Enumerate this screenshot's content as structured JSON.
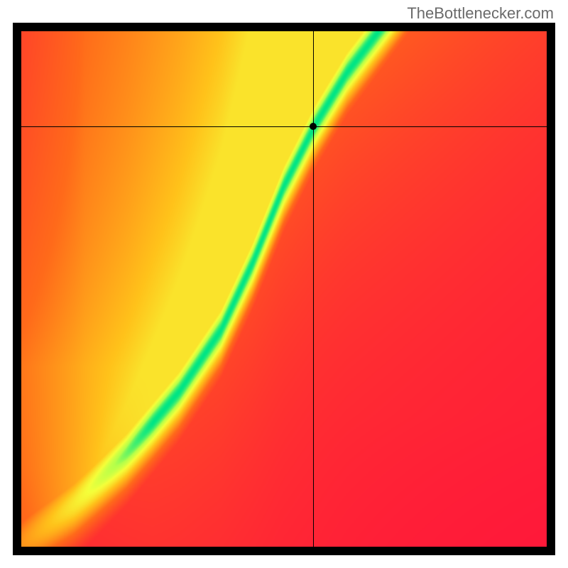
{
  "watermark": "TheBottlenecker.com",
  "chart_data": {
    "type": "heatmap",
    "title": "",
    "xlabel": "",
    "ylabel": "",
    "xlim": [
      0,
      1
    ],
    "ylim": [
      0,
      1
    ],
    "crosshair": {
      "x": 0.555,
      "y": 0.815
    },
    "ridge_curve": [
      {
        "x": 0.0,
        "y": 0.0
      },
      {
        "x": 0.1,
        "y": 0.08
      },
      {
        "x": 0.2,
        "y": 0.18
      },
      {
        "x": 0.3,
        "y": 0.3
      },
      {
        "x": 0.38,
        "y": 0.42
      },
      {
        "x": 0.44,
        "y": 0.55
      },
      {
        "x": 0.5,
        "y": 0.7
      },
      {
        "x": 0.56,
        "y": 0.82
      },
      {
        "x": 0.62,
        "y": 0.92
      },
      {
        "x": 0.68,
        "y": 1.0
      }
    ],
    "color_stops": [
      {
        "value": 0.0,
        "color": "#ff173a"
      },
      {
        "value": 0.45,
        "color": "#ff6a1a"
      },
      {
        "value": 0.7,
        "color": "#ffc21a"
      },
      {
        "value": 0.85,
        "color": "#f5ff3a"
      },
      {
        "value": 0.93,
        "color": "#b6ff4a"
      },
      {
        "value": 1.0,
        "color": "#00e585"
      }
    ],
    "ridge_width": 0.055,
    "corner_bias": {
      "top_right": 0.78,
      "bottom_right": 0.0,
      "top_left": 0.0,
      "bottom_left": 0.0
    }
  }
}
